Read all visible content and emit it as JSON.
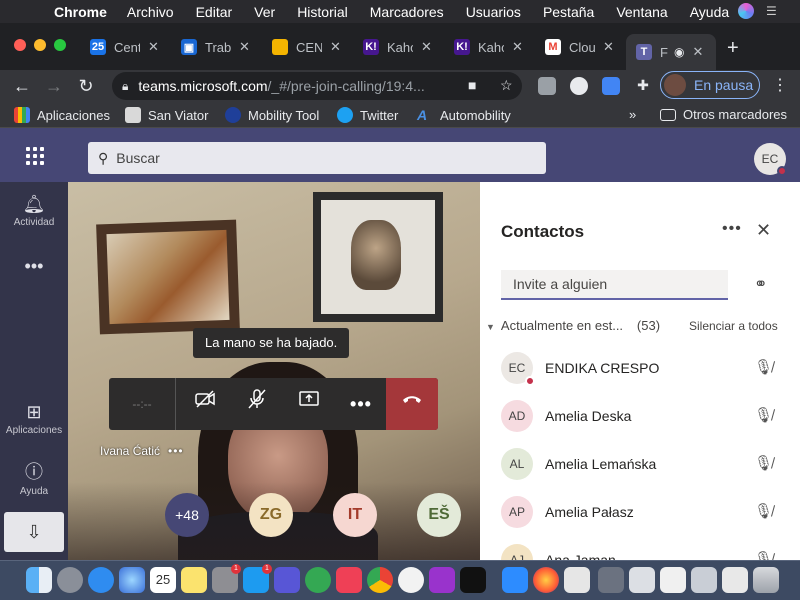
{
  "menubar": {
    "app_name": "Chrome",
    "items": [
      "Archivo",
      "Editar",
      "Ver",
      "Historial",
      "Marcadores",
      "Usuarios",
      "Pestaña",
      "Ventana",
      "Ayuda"
    ]
  },
  "tabs": [
    {
      "title": "Cent",
      "icon": "calendar-icon",
      "color": "#1a73e8"
    },
    {
      "title": "Trab",
      "icon": "classroom-icon",
      "color": "#1967d2"
    },
    {
      "title": "CEN",
      "icon": "slides-icon",
      "color": "#f4b400"
    },
    {
      "title": "Kaho",
      "icon": "kahoot-icon",
      "color": "#46178f"
    },
    {
      "title": "Kaho",
      "icon": "kahoot-icon",
      "color": "#46178f"
    },
    {
      "title": "Clou",
      "icon": "gmail-icon",
      "color": "#ea4335"
    },
    {
      "title": "F",
      "icon": "teams-icon",
      "color": "#6264a7"
    }
  ],
  "address_bar": {
    "domain": "teams.microsoft.com",
    "path": "/_#/pre-join-calling/19:4..."
  },
  "profile": {
    "label": "En pausa"
  },
  "bookmarks": [
    {
      "label": "Aplicaciones",
      "icon": "apps-grid-icon"
    },
    {
      "label": "San Viator",
      "icon": "school-icon"
    },
    {
      "label": "Mobility Tool",
      "icon": "eu-stars-icon"
    },
    {
      "label": "Twitter",
      "icon": "twitter-icon"
    },
    {
      "label": "Automobility",
      "icon": "automobility-icon"
    }
  ],
  "other_bookmarks": "Otros marcadores",
  "teams": {
    "search_placeholder": "Buscar",
    "me_initials": "EC",
    "rail": [
      {
        "label": "Actividad",
        "icon": "bell-icon"
      },
      {
        "label": "Aplicaciones",
        "icon": "apps-icon"
      },
      {
        "label": "Ayuda",
        "icon": "help-icon"
      }
    ]
  },
  "call": {
    "toast": "La mano se ha bajado.",
    "timer": "--:--",
    "presenter": "Ivana Ćatić",
    "participant_bubbles": [
      {
        "label": "+48",
        "bg": "#464775",
        "fg": "#ffffff"
      },
      {
        "label": "ZG",
        "bg": "#f3e3c3",
        "fg": "#8a6a2a"
      },
      {
        "label": "IT",
        "bg": "#f6d7d1",
        "fg": "#a33b2b"
      },
      {
        "label": "EŠ",
        "bg": "#e3ead9",
        "fg": "#4f6a37"
      }
    ]
  },
  "contacts": {
    "title": "Contactos",
    "invite_placeholder": "Invite a alguien",
    "section_title": "Actualmente en est...",
    "section_count": "(53)",
    "mute_all": "Silenciar a todos",
    "people": [
      {
        "initials": "EC",
        "name": "ENDIKA CRESPO",
        "bg": "#ece8e4",
        "status": true
      },
      {
        "initials": "AD",
        "name": "Amelia Deska",
        "bg": "#f6dbe0",
        "status": false
      },
      {
        "initials": "AL",
        "name": "Amelia Lemańska",
        "bg": "#e3ead9",
        "status": false
      },
      {
        "initials": "AP",
        "name": "Amelia Pałasz",
        "bg": "#f6dbe0",
        "status": false
      },
      {
        "initials": "AJ",
        "name": "Ana Jaman",
        "bg": "#f3e3c3",
        "status": false
      }
    ]
  },
  "dock": {
    "calendar_day": "25",
    "badges": [
      "1",
      "1"
    ]
  }
}
